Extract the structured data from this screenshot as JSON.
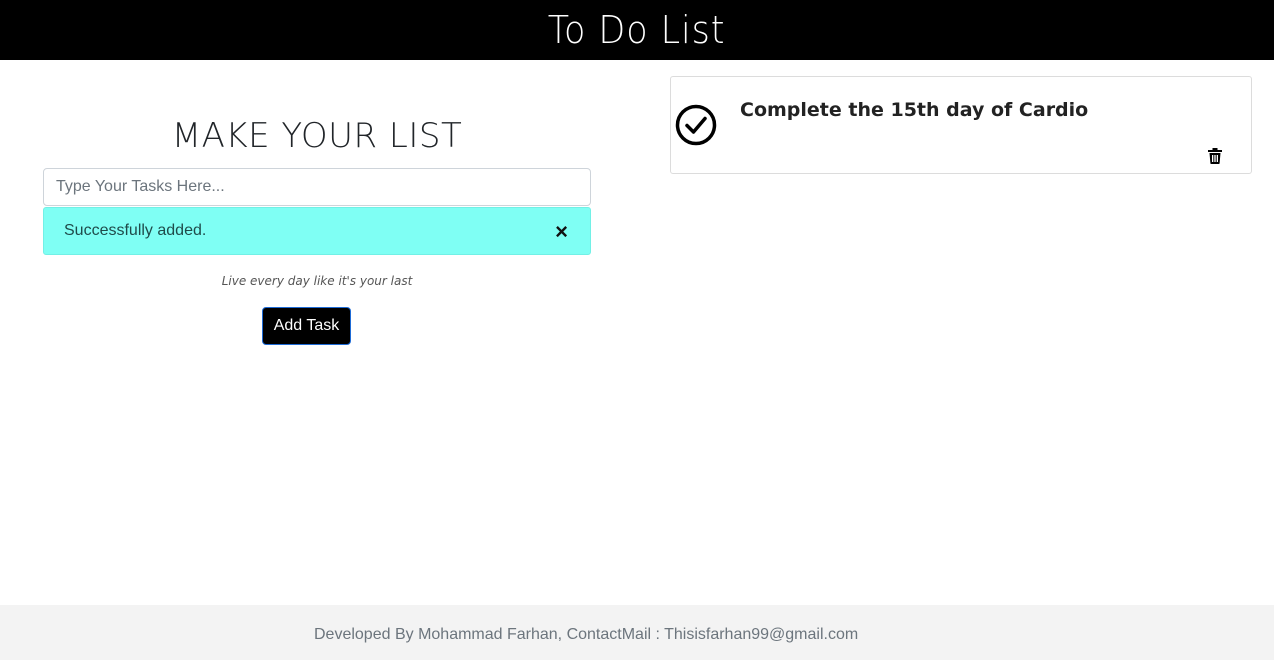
{
  "header": {
    "title": "To Do List"
  },
  "form": {
    "heading": "MAKE YOUR LIST",
    "input_placeholder": "Type Your Tasks Here...",
    "input_value": "",
    "alert_text": "Successfully added.",
    "alert_close": "×",
    "quote": "Live every day like it's your last",
    "add_button_label": "Add Task"
  },
  "tasks": [
    {
      "text": "Complete the 15th day of Cardio",
      "icon": "check-circle-icon",
      "delete_icon": "trash-icon"
    }
  ],
  "footer": {
    "text": "Developed By Mohammad Farhan, ContactMail : Thisisfarhan99@gmail.com"
  },
  "colors": {
    "header_bg": "#000000",
    "alert_bg": "#7ffff4",
    "button_bg": "#000000",
    "footer_bg": "#f3f3f3"
  }
}
